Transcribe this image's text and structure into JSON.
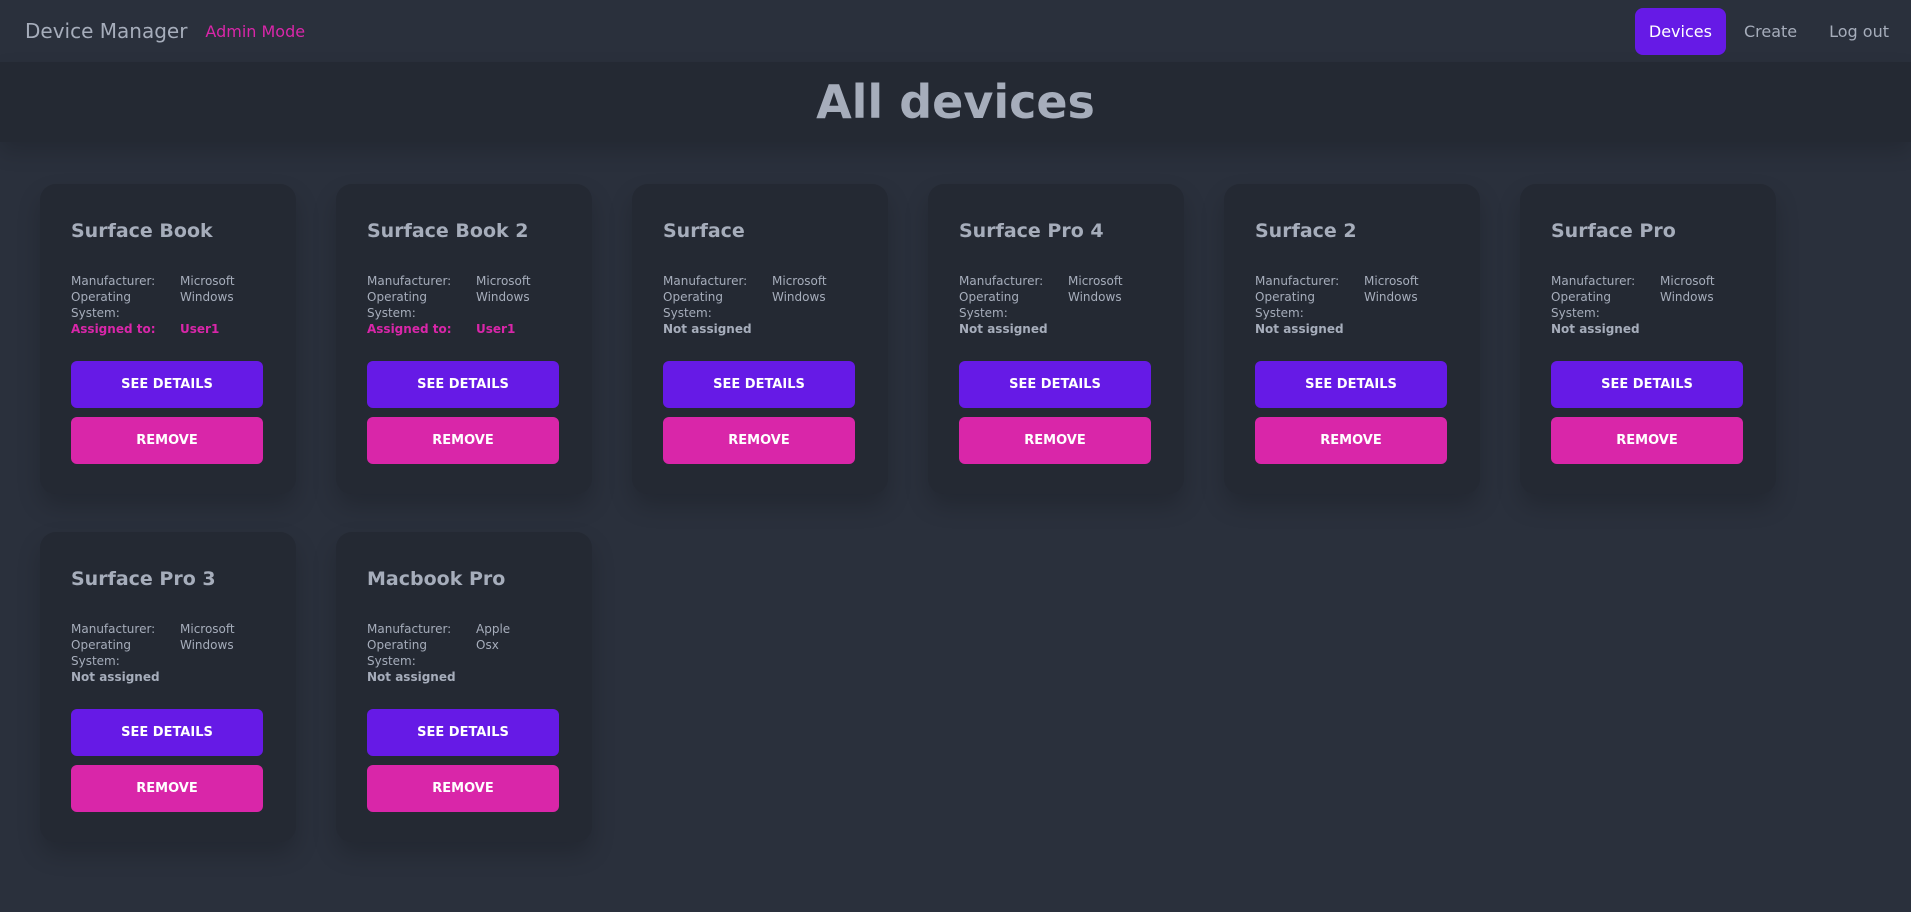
{
  "navbar": {
    "title": "Device Manager",
    "mode": "Admin Mode",
    "links": [
      "Devices",
      "Create",
      "Log out"
    ]
  },
  "page": {
    "title": "All devices"
  },
  "labels": {
    "manufacturer": "Manufacturer:",
    "os": "Operating System:",
    "assigned_to": "Assigned to:",
    "not_assigned": "Not assigned",
    "see_details": "SEE DETAILS",
    "remove": "REMOVE"
  },
  "colors": {
    "primary": "#661ae6",
    "secondary": "#d926a9",
    "background": "#2a303c",
    "card": "#242933"
  },
  "devices": [
    {
      "name": "Surface Book",
      "manufacturer": "Microsoft",
      "os": "Windows",
      "assigned_to": "User1"
    },
    {
      "name": "Surface Book 2",
      "manufacturer": "Microsoft",
      "os": "Windows",
      "assigned_to": "User1"
    },
    {
      "name": "Surface",
      "manufacturer": "Microsoft",
      "os": "Windows",
      "assigned_to": null
    },
    {
      "name": "Surface Pro 4",
      "manufacturer": "Microsoft",
      "os": "Windows",
      "assigned_to": null
    },
    {
      "name": "Surface 2",
      "manufacturer": "Microsoft",
      "os": "Windows",
      "assigned_to": null
    },
    {
      "name": "Surface Pro",
      "manufacturer": "Microsoft",
      "os": "Windows",
      "assigned_to": null
    },
    {
      "name": "Surface Pro 3",
      "manufacturer": "Microsoft",
      "os": "Windows",
      "assigned_to": null
    },
    {
      "name": "Macbook Pro",
      "manufacturer": "Apple",
      "os": "Osx",
      "assigned_to": null
    }
  ]
}
